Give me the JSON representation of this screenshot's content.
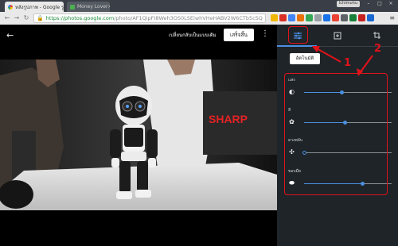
{
  "browser": {
    "tabs": [
      {
        "label": "หลังรูปภาพ - Google รูปภาพ",
        "active": true
      },
      {
        "label": "Money Lover",
        "active": false
      }
    ],
    "user_chip": "Ichimuhu",
    "url_host": "https://photos.google.com",
    "url_path": "/photo/AF1QipFI8Weh3OS0LSEiwhVHeHABV2W6CTb5cSQ"
  },
  "editor": {
    "revert_label": "เปลี่ยนกลับเป็นแบบเดิม",
    "done_label": "เสร็จสิ้น",
    "brand_sign": "SHARP"
  },
  "panel": {
    "tabs": [
      {
        "icon": "sliders-icon",
        "active": true
      },
      {
        "icon": "add-frame-icon",
        "active": false
      },
      {
        "icon": "crop-rotate-icon",
        "active": false
      }
    ],
    "auto_label": "อัตโนมัติ",
    "adjustments": [
      {
        "label": "แสง",
        "icon": "brightness-icon",
        "value": 0.43
      },
      {
        "label": "สี",
        "icon": "palette-icon",
        "value": 0.46
      },
      {
        "label": "ดวงพลับ",
        "icon": "pop-icon",
        "value": 0.0
      },
      {
        "label": "ขอบมืด",
        "icon": "vignette-icon",
        "value": 0.66
      }
    ]
  },
  "annotations": {
    "label_1": "1",
    "label_2": "2",
    "color": "#e0131b"
  },
  "colors": {
    "accent": "#4a90e2",
    "panel_bg": "#1f2428"
  }
}
